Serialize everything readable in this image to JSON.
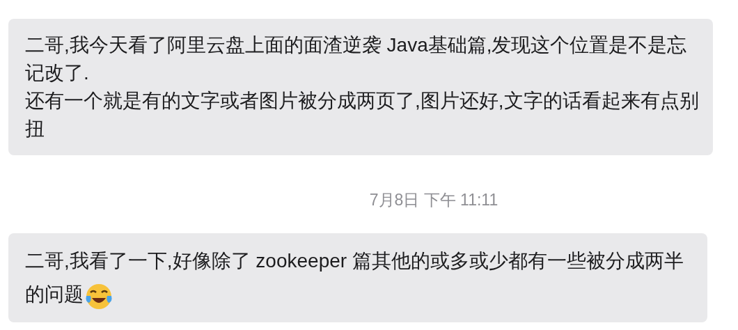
{
  "messages": [
    {
      "paragraphs": [
        "二哥,我今天看了阿里云盘上面的面渣逆袭 Java基础篇,发现这个位置是不是忘记改了.",
        "还有一个就是有的文字或者图片被分成两页了,图片还好,文字的话看起来有点别扭"
      ],
      "emoji_after": false
    },
    {
      "timestamp": "7月8日 下午 11:11"
    },
    {
      "paragraphs": [
        "二哥,我看了一下,好像除了 zookeeper 篇其他的或多或少都有一些被分成两半的问题"
      ],
      "emoji_after": true
    }
  ]
}
